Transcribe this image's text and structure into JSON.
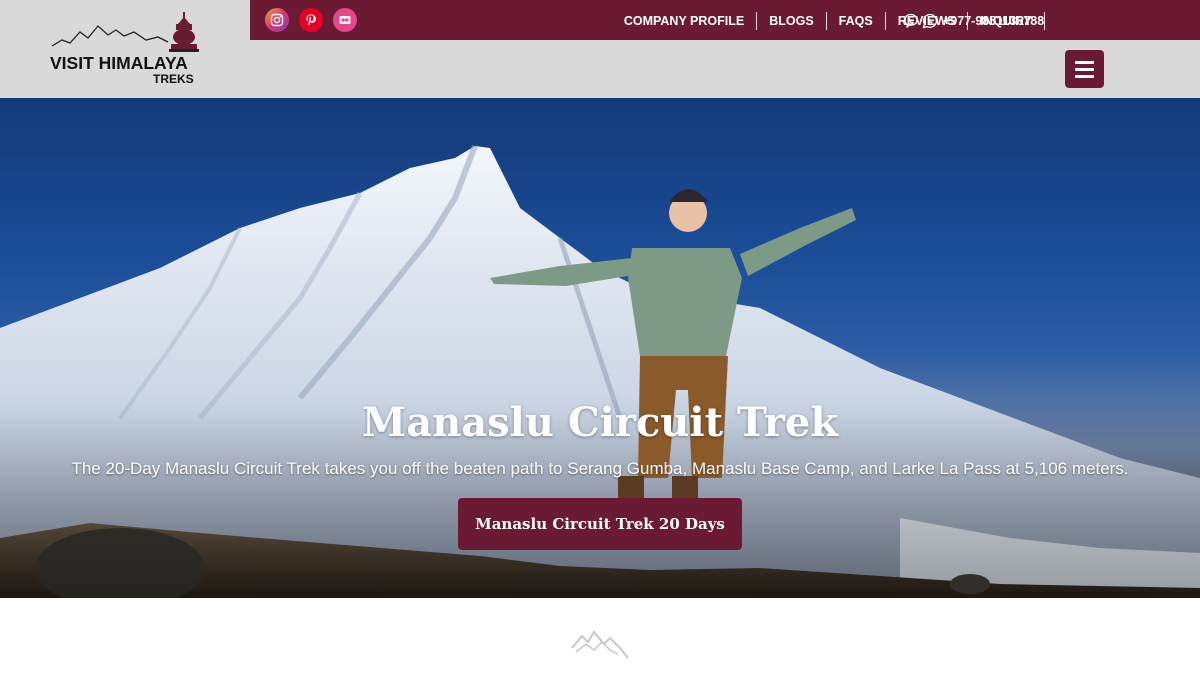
{
  "header": {
    "logo": {
      "brand": "VISIT HIMALAYA",
      "sub": "TREKS"
    },
    "social": [
      {
        "icon": "instagram-icon"
      },
      {
        "icon": "pinterest-icon"
      },
      {
        "icon": "flickr-icon"
      }
    ],
    "nav": [
      {
        "label": "COMPANY PROFILE"
      },
      {
        "label": "BLOGS"
      },
      {
        "label": "FAQS"
      },
      {
        "label": "REVIEWS"
      },
      {
        "label": "INQUIRY"
      }
    ],
    "contact": {
      "phone": "+977-9851136788",
      "icons": [
        "viber-icon",
        "whatsapp-icon"
      ]
    },
    "menu_icon": "hamburger-icon"
  },
  "hero": {
    "title": "Manaslu Circuit Trek",
    "subtitle": "The 20-Day Manaslu Circuit Trek takes you off the beaten path to Serang Gumba, Manaslu Base Camp, and Larke La Pass at 5,106 meters.",
    "cta_label": "Manaslu Circuit Trek 20 Days"
  },
  "section": {
    "divider_icon": "mountain-icon"
  },
  "colors": {
    "brand": "#6a1b33",
    "header_bg": "#d9d9d9",
    "text_light": "#ffffff"
  }
}
